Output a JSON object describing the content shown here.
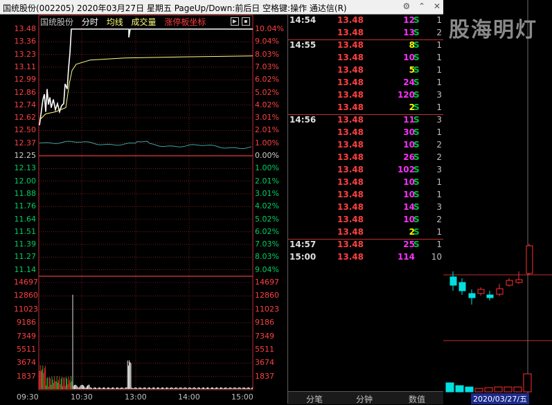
{
  "window": {
    "title": "国统股份(002205)  2020年03月27日 星期五 PageUp/Down:前后日 空格键:操作 通达信(R)",
    "icons": [
      "settings-icon",
      "chevron-up-icon",
      "close-icon"
    ],
    "icon_glyphs": [
      "⚙",
      "⌃",
      "✕"
    ]
  },
  "chart": {
    "stock_name": "国统股份",
    "tab_minute": "分时",
    "tab_avg": "均线",
    "tab_volume": "成交量",
    "tab_limit": "涨停板坐标",
    "price_axis": [
      "13.48",
      "13.36",
      "13.23",
      "13.11",
      "12.99",
      "12.86",
      "12.74",
      "12.62",
      "12.50",
      "12.37",
      "12.25",
      "12.13",
      "12.00",
      "11.88",
      "11.76",
      "11.64",
      "11.51",
      "11.39",
      "11.27",
      "11.14"
    ],
    "pct_axis": [
      "10.04%",
      "9.04%",
      "8.03%",
      "7.03%",
      "6.02%",
      "5.02%",
      "4.02%",
      "3.01%",
      "2.01%",
      "1.00%",
      "0.00%",
      "1.00%",
      "2.01%",
      "3.01%",
      "4.02%",
      "5.02%",
      "6.02%",
      "7.03%",
      "8.03%",
      "9.04%"
    ],
    "volume_axis": [
      "14697",
      "12860",
      "11023",
      "9186",
      "7349",
      "5511",
      "3674",
      "1837"
    ],
    "time_axis": [
      "09:30",
      "10:30",
      "13:00",
      "14:00",
      "15:00"
    ],
    "colors": {
      "up": "#ff3030",
      "down": "#00e0e0",
      "grid": "#c03030",
      "price_line": "#ffffff",
      "avg_line": "#ffff80",
      "index_line": "#40a0a0"
    }
  },
  "ticks": [
    {
      "time": "14:54",
      "price": "13.48",
      "vol": "12",
      "side": "S",
      "cnt": "1",
      "vc": "#ff30ff"
    },
    {
      "time": "",
      "price": "13.48",
      "vol": "13",
      "side": "S",
      "cnt": "2",
      "vc": "#ff30ff"
    },
    {
      "time": "14:55",
      "price": "13.48",
      "vol": "8",
      "side": "S",
      "cnt": "1",
      "vc": "#ffff00"
    },
    {
      "time": "",
      "price": "13.48",
      "vol": "10",
      "side": "S",
      "cnt": "1",
      "vc": "#ff30ff"
    },
    {
      "time": "",
      "price": "13.48",
      "vol": "5",
      "side": "S",
      "cnt": "1",
      "vc": "#ffff00"
    },
    {
      "time": "",
      "price": "13.48",
      "vol": "24",
      "side": "S",
      "cnt": "1",
      "vc": "#ff30ff"
    },
    {
      "time": "",
      "price": "13.48",
      "vol": "120",
      "side": "S",
      "cnt": "3",
      "vc": "#ff30ff"
    },
    {
      "time": "",
      "price": "13.48",
      "vol": "2",
      "side": "S",
      "cnt": "1",
      "vc": "#ffff00"
    },
    {
      "time": "14:56",
      "price": "13.48",
      "vol": "11",
      "side": "S",
      "cnt": "3",
      "vc": "#ff30ff"
    },
    {
      "time": "",
      "price": "13.48",
      "vol": "30",
      "side": "S",
      "cnt": "1",
      "vc": "#ff30ff"
    },
    {
      "time": "",
      "price": "13.48",
      "vol": "10",
      "side": "S",
      "cnt": "2",
      "vc": "#ff30ff"
    },
    {
      "time": "",
      "price": "13.48",
      "vol": "26",
      "side": "S",
      "cnt": "2",
      "vc": "#ff30ff"
    },
    {
      "time": "",
      "price": "13.48",
      "vol": "102",
      "side": "S",
      "cnt": "3",
      "vc": "#ff30ff"
    },
    {
      "time": "",
      "price": "13.48",
      "vol": "10",
      "side": "S",
      "cnt": "1",
      "vc": "#ff30ff"
    },
    {
      "time": "",
      "price": "13.48",
      "vol": "10",
      "side": "S",
      "cnt": "1",
      "vc": "#ff30ff"
    },
    {
      "time": "",
      "price": "13.48",
      "vol": "14",
      "side": "S",
      "cnt": "3",
      "vc": "#ff30ff"
    },
    {
      "time": "",
      "price": "13.48",
      "vol": "10",
      "side": "S",
      "cnt": "2",
      "vc": "#ff30ff"
    },
    {
      "time": "",
      "price": "13.48",
      "vol": "2",
      "side": "S",
      "cnt": "1",
      "vc": "#ffff00"
    },
    {
      "time": "14:57",
      "price": "13.48",
      "vol": "25",
      "side": "S",
      "cnt": "1",
      "vc": "#ff30ff"
    },
    {
      "time": "15:00",
      "price": "13.48",
      "vol": "114",
      "side": "",
      "cnt": "10",
      "vc": "#ff30ff"
    }
  ],
  "tabs": [
    "分笔",
    "分钟",
    "数值"
  ],
  "sidebar": {
    "watermark": "股海明灯",
    "date": "2020/03/27/五"
  }
}
